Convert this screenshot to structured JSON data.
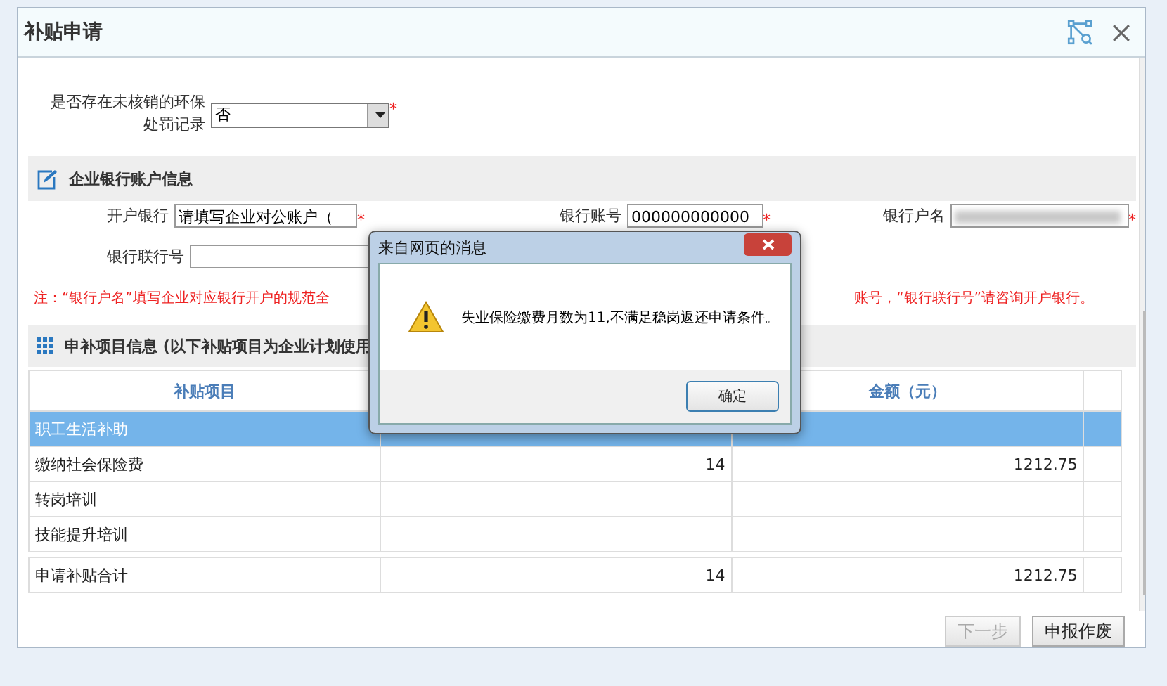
{
  "dialog": {
    "title": "补贴申请"
  },
  "penalty": {
    "label": "是否存在未核销的环保处罚记录",
    "value": "否",
    "mark": "*"
  },
  "bank_section": {
    "title": "企业银行账户信息",
    "fields": [
      {
        "label": "开户银行",
        "value": "请填写企业对公账户（",
        "mark": "*"
      },
      {
        "label": "银行账号",
        "value": "000000000000",
        "mark": "*"
      },
      {
        "label": "银行户名",
        "blurred": true,
        "mark": "*"
      },
      {
        "label": "银行联行号"
      }
    ],
    "note_parts": [
      "注：“银行户名”填写企业对应银行开户的规范全",
      "账号，“银行联行号”请咨询开户银行。"
    ]
  },
  "items_section": {
    "title": "申补项目信息 (以下补贴项目为企业计划使用",
    "column_1": "补贴项目",
    "column_3": "金额（元）",
    "rows": [
      {
        "item": "职工生活补助",
        "selected": true
      },
      {
        "item": "缴纳社会保险费",
        "column_2": "14",
        "amount": "1212.75",
        "selected": false
      },
      {
        "item": "转岗培训",
        "selected": false
      },
      {
        "item": "技能提升培训",
        "selected": false
      }
    ],
    "total": {
      "item": "申请补贴合计",
      "column_2": "14",
      "amount": "1212.75"
    }
  },
  "buttons": [
    {
      "label": "下一步",
      "disabled": true
    },
    {
      "label": "申报作废",
      "disabled": false
    }
  ],
  "alert": {
    "title": "来自网页的消息",
    "message": "失业保险缴费月数为11,不满足稳岗返还申请条件。",
    "button": "确定"
  }
}
